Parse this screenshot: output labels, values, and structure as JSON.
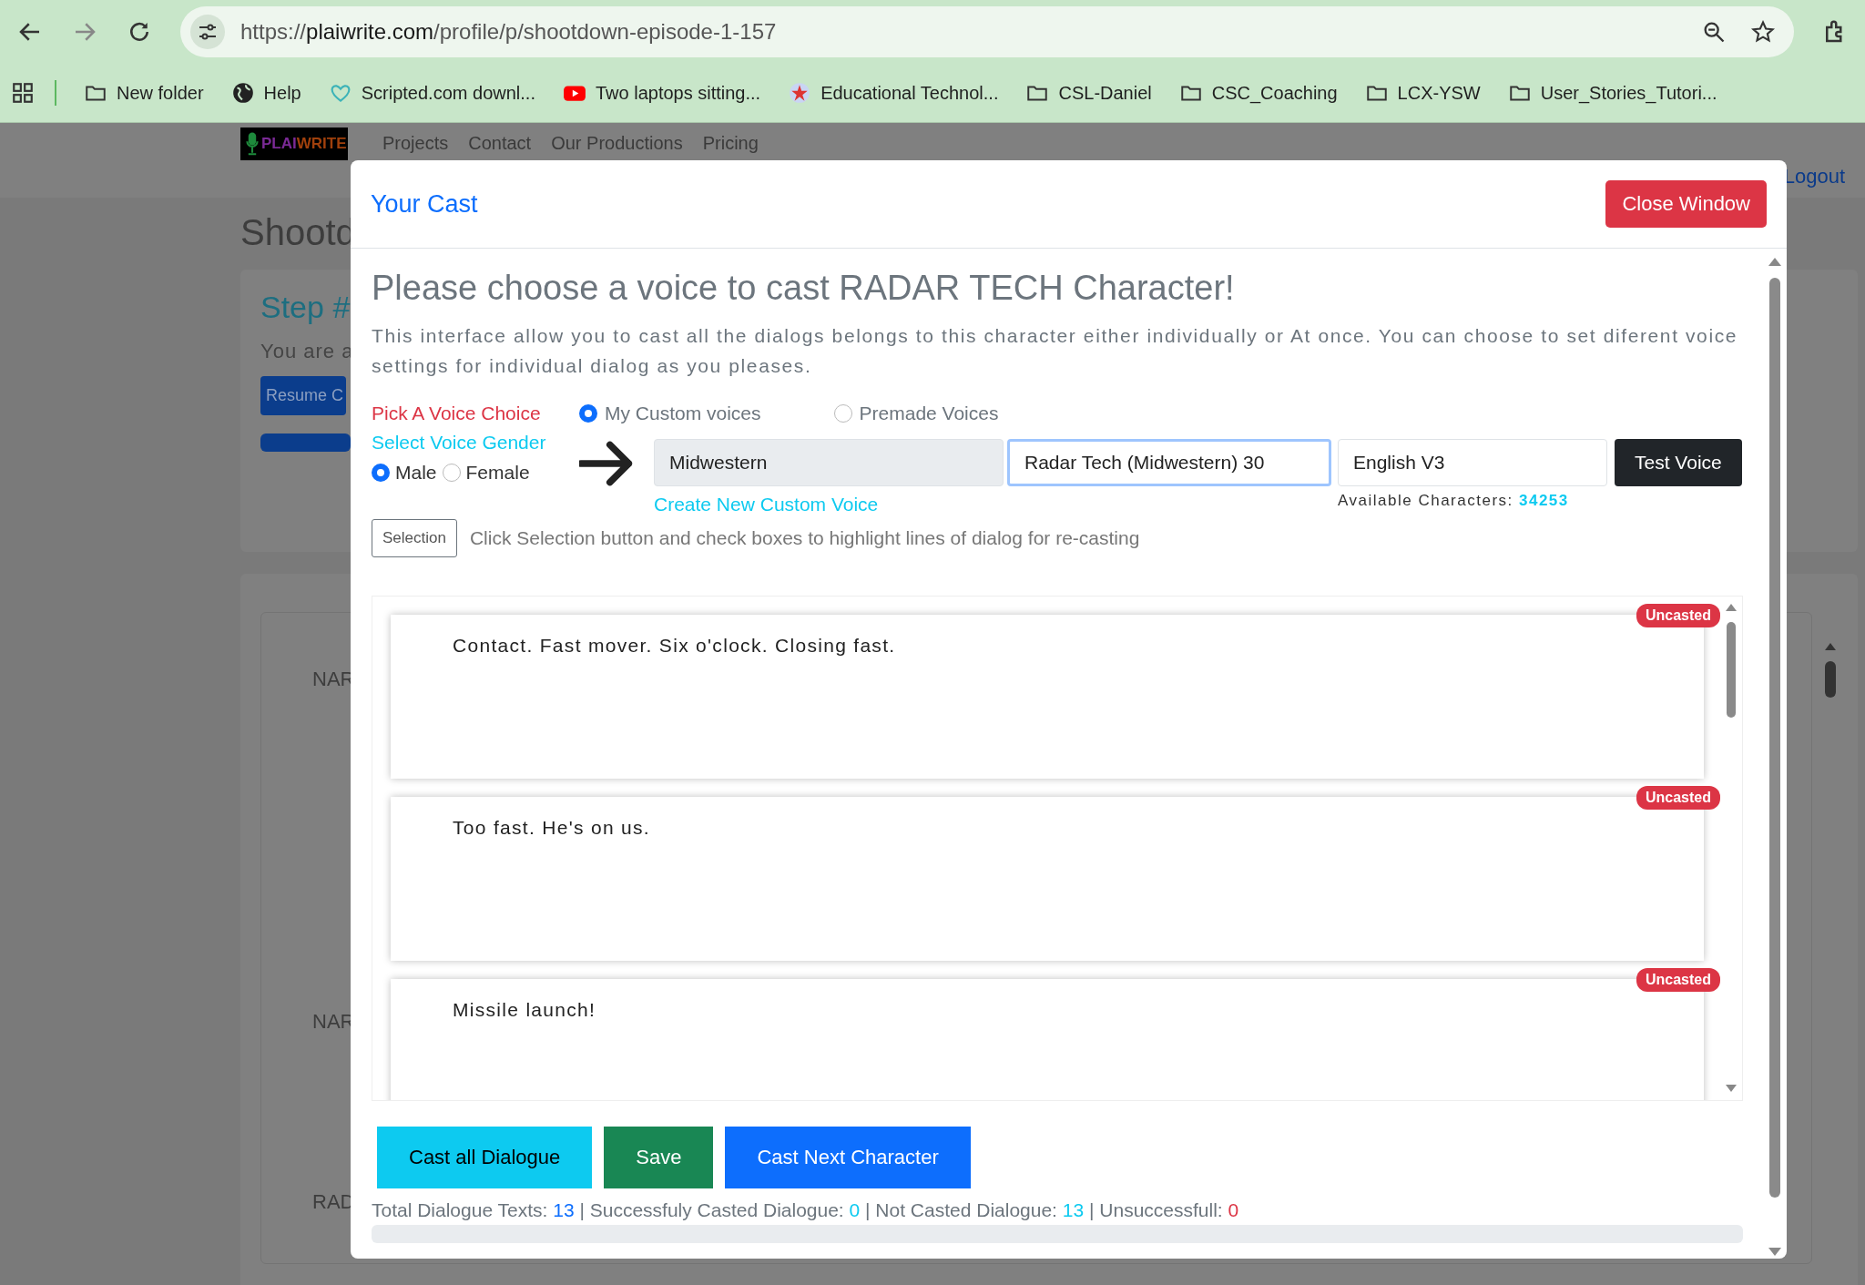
{
  "browser": {
    "url": {
      "scheme": "https://",
      "host": "plaiwrite.com",
      "path": "/profile/p/shootdown-episode-1-157"
    },
    "bookmarks": [
      {
        "kind": "folder",
        "label": "New folder"
      },
      {
        "kind": "site",
        "label": "Help"
      },
      {
        "kind": "site2",
        "label": "Scripted.com downl..."
      },
      {
        "kind": "video",
        "label": "Two laptops sitting..."
      },
      {
        "kind": "site3",
        "label": "Educational Technol..."
      },
      {
        "kind": "folder",
        "label": "CSL-Daniel"
      },
      {
        "kind": "folder",
        "label": "CSC_Coaching"
      },
      {
        "kind": "folder",
        "label": "LCX-YSW"
      },
      {
        "kind": "folder",
        "label": "User_Stories_Tutori..."
      }
    ]
  },
  "page": {
    "logo": {
      "part_1": "PLAI",
      "part_2": "WRITE"
    },
    "nav": [
      "Projects",
      "Contact",
      "Our Productions",
      "Pricing"
    ],
    "logout": "Logout",
    "title": "Shootd",
    "step": {
      "heading": "Step #",
      "text": "You are a",
      "button": "Resume C"
    },
    "rows": [
      "NAR",
      "NAR",
      "RAD"
    ]
  },
  "modal": {
    "title": "Your Cast",
    "close": "Close Window",
    "heading": "Please choose a voice to cast RADAR TECH Character!",
    "description": "This interface allow you to cast all the dialogs belongs to this character either individually or At once. You can choose to set diferent voice settings for individual dialog as you pleases.",
    "voice_choice_label": "Pick A Voice Choice",
    "voice_sources": [
      {
        "label": "My Custom voices",
        "selected": true
      },
      {
        "label": "Premade Voices",
        "selected": false
      }
    ],
    "gender_label": "Select Voice Gender",
    "genders": [
      {
        "label": "Male",
        "selected": true
      },
      {
        "label": "Female",
        "selected": false
      }
    ],
    "voice_field": {
      "value": "Midwestern"
    },
    "voice_name_field": {
      "value": "Radar Tech (Midwestern) 30"
    },
    "model_field": {
      "value": "English V3"
    },
    "test_button": "Test Voice",
    "create_link": "Create New Custom Voice",
    "available": {
      "label": "Available Characters:",
      "value": "34253"
    },
    "selection_button": "Selection",
    "selection_hint": "Click Selection button and check boxes to highlight lines of dialog for re-casting",
    "dialogues": [
      {
        "text": "Contact. Fast mover. Six o'clock. Closing fast.",
        "status": "Uncasted"
      },
      {
        "text": "Too fast. He's on us.",
        "status": "Uncasted"
      },
      {
        "text": "Missile launch!",
        "status": "Uncasted"
      }
    ],
    "actions": [
      {
        "kind": "info",
        "label": "Cast all Dialogue"
      },
      {
        "kind": "success",
        "label": "Save"
      },
      {
        "kind": "primary",
        "label": "Cast Next Character"
      }
    ],
    "stats": [
      {
        "label": "Total Dialogue Texts:",
        "value": "13",
        "color": "#0d6efd"
      },
      {
        "label": "Successfuly Casted Dialogue:",
        "value": "0",
        "color": "#0dcaf0"
      },
      {
        "label": "Not Casted Dialogue:",
        "value": "13",
        "color": "#0dcaf0"
      },
      {
        "label": "Unsuccessfull:",
        "value": "0",
        "color": "#dc3545"
      }
    ],
    "separator": "|",
    "progress": {
      "level": 0
    }
  }
}
